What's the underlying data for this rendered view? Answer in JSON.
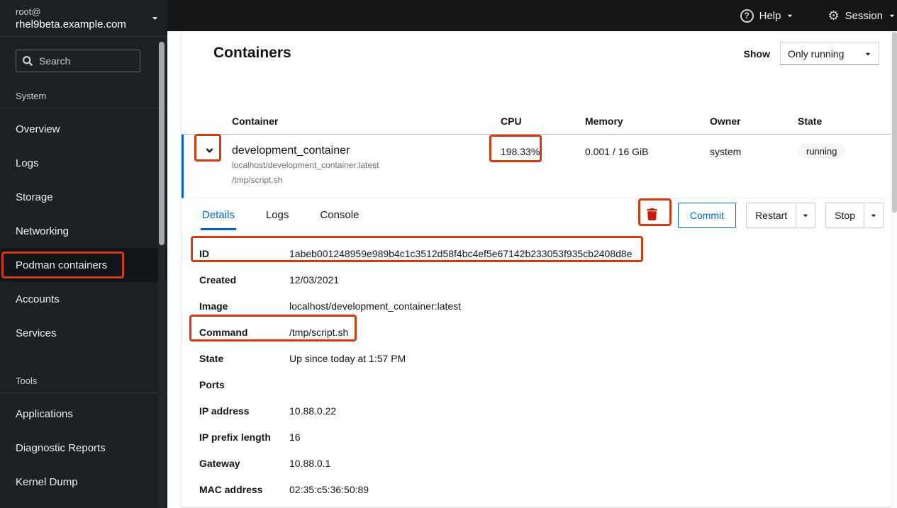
{
  "masthead": {
    "host_user": "root@",
    "host_name": "rhel9beta.example.com",
    "help_label": "Help",
    "session_label": "Session"
  },
  "sidebar": {
    "search_placeholder": "Search",
    "sections": [
      {
        "title": "System",
        "items": [
          "Overview",
          "Logs",
          "Storage",
          "Networking",
          "Podman containers",
          "Accounts",
          "Services"
        ]
      },
      {
        "title": "Tools",
        "items": [
          "Applications",
          "Diagnostic Reports",
          "Kernel Dump"
        ]
      }
    ],
    "active_item": "Podman containers"
  },
  "page": {
    "title": "Containers",
    "show_label": "Show",
    "filter_value": "Only running"
  },
  "table": {
    "columns": [
      "Container",
      "CPU",
      "Memory",
      "Owner",
      "State"
    ],
    "row": {
      "name": "development_container",
      "image": "localhost/development_container:latest",
      "command": "/tmp/script.sh",
      "cpu": "198.33%",
      "memory": "0.001 / 16 GiB",
      "owner": "system",
      "state": "running"
    }
  },
  "detail": {
    "tabs": [
      "Details",
      "Logs",
      "Console"
    ],
    "active_tab": "Details",
    "actions": {
      "commit": "Commit",
      "restart": "Restart",
      "stop": "Stop"
    },
    "fields": [
      {
        "label": "ID",
        "value": "1abeb001248959e989b4c1c3512d58f4bc4ef5e67142b233053f935cb2408d8e"
      },
      {
        "label": "Created",
        "value": "12/03/2021"
      },
      {
        "label": "Image",
        "value": "localhost/development_container:latest"
      },
      {
        "label": "Command",
        "value": "/tmp/script.sh"
      },
      {
        "label": "State",
        "value": "Up since today at 1:57 PM"
      },
      {
        "label": "Ports",
        "value": ""
      },
      {
        "label": "IP address",
        "value": "10.88.0.22"
      },
      {
        "label": "IP prefix length",
        "value": "16"
      },
      {
        "label": "Gateway",
        "value": "10.88.0.1"
      },
      {
        "label": "MAC address",
        "value": "02:35:c5:36:50:89"
      }
    ]
  },
  "colors": {
    "accent": "#0066cc",
    "annotation": "#ce3c12",
    "danger": "#c9190b",
    "masthead_bg": "#151515",
    "sidebar_bg": "#1d2025",
    "badge_bg": "#f5f5f5"
  }
}
